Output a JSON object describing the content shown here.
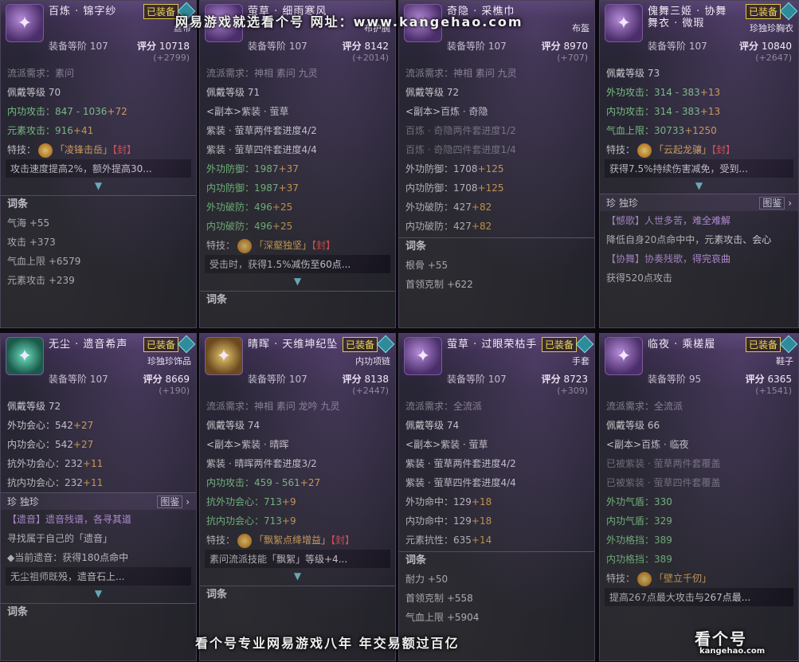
{
  "watermark_top": "网易游戏就选看个号  网址：www.kangehao.com",
  "watermark_bottom": "看个号专业网易游戏八年  年交易额过百亿",
  "logo_text": "看个号",
  "logo_sub": "kangehao.com",
  "labels": {
    "equipped": "已装备",
    "gear_level": "装备等阶",
    "score": "评分",
    "school_req": "流派需求：",
    "wear_level": "佩戴等级",
    "skill": "特技：",
    "entries": "词条",
    "rare": "珍 独珍",
    "tujian": "图鉴"
  },
  "cards": [
    {
      "title": "百炼 · 锦字纱",
      "subtype": "丝带",
      "gear_level": "107",
      "score": "10718",
      "plus": "(+2799)",
      "school": "素问",
      "wear_level": "70",
      "stats": [
        "内功攻击：847 - 1036",
        "元素攻击：916"
      ],
      "stat_bonus": [
        "+72",
        "+41"
      ],
      "skill_name": "「凌锋击岳」",
      "skill_seal": "【封】",
      "skill_desc": "攻击速度提高2%，额外提高30...",
      "entries": [
        "气海 +55",
        "攻击 +373",
        "气血上限 +6579",
        "元素攻击 +239"
      ]
    },
    {
      "title": "萤草 · 细雨寒风",
      "subtype": "布护腕",
      "gear_level": "107",
      "score": "8142",
      "plus": "(+2014)",
      "school": "神相 素问 九灵",
      "wear_level": "71",
      "sets": [
        "<副本>紫装 · 萤草",
        "紫装 · 萤草两件套进度4/2",
        "紫装 · 萤草四件套进度4/4"
      ],
      "stats": [
        "外功防御：1987",
        "内功防御：1987",
        "外功破防：496",
        "内功破防：496"
      ],
      "stat_bonus": [
        "+37",
        "+37",
        "+25",
        "+25"
      ],
      "skill_name": "「深壑独坚」",
      "skill_seal": "【封】",
      "skill_desc": "受击时，获得1.5%减伤至60点...",
      "entries_label": "词条"
    },
    {
      "title": "奇隐 · 采樵巾",
      "subtype": "布盔",
      "gear_level": "107",
      "score": "8970",
      "plus": "(+707)",
      "school": "神相 素问 九灵",
      "wear_level": "72",
      "sets": [
        "<副本>百炼 · 奇隐",
        "百炼 · 奇隐两件套进度1/2",
        "百炼 · 奇隐四件套进度1/4"
      ],
      "stats": [
        "外功防御：1708",
        "内功防御：1708",
        "外功破防：427",
        "内功破防：427"
      ],
      "stat_bonus": [
        "+125",
        "+125",
        "+82",
        "+82"
      ],
      "entries": [
        "根骨 +55",
        "首领克制 +622"
      ]
    },
    {
      "title": "傀舞三姬 · 协舞 舞衣 · 微瑕",
      "subtype": "珍独珍胸衣",
      "gear_level": "107",
      "score": "10840",
      "plus": "(+2647)",
      "wear_level": "73",
      "stats": [
        "外功攻击：314 - 383",
        "内功攻击：314 - 383",
        "气血上限：30733"
      ],
      "stat_bonus": [
        "+13",
        "+13",
        "+1250"
      ],
      "skill_name": "「云起龙骧」",
      "skill_seal": "【封】",
      "skill_desc": "获得7.5%持续伤害减免，受到...",
      "rare_lines": [
        "【憾歌】人世多苦，难全难解",
        "降低自身20点命中中，元素攻击、会心",
        "【协舞】协奏残歌，得完哀曲",
        "获得520点攻击"
      ]
    },
    {
      "title": "无尘 · 遗音希声",
      "subtype": "珍独珍饰品",
      "gear_level": "107",
      "score": "8669",
      "plus": "(+190)",
      "wear_level": "72",
      "stats": [
        "外功会心：542",
        "内功会心：542",
        "抗外功会心：232",
        "抗内功会心：232"
      ],
      "stat_bonus": [
        "+27",
        "+27",
        "+11",
        "+11"
      ],
      "rare_lines": [
        "【遗音】遗音残谱，各寻其道",
        "寻找属于自己的「遗音」",
        "◆当前遗音：获得180点命中"
      ],
      "skill_desc": "无尘祖师既殁，遗音石上...",
      "entries_label": "词条"
    },
    {
      "title": "晴晖 · 天维坤纪坠",
      "subtype": "内功项链",
      "gear_level": "107",
      "score": "8138",
      "plus": "(+2447)",
      "school": "神相 素问 龙吟 九灵",
      "wear_level": "74",
      "sets": [
        "<副本>紫装 · 晴晖",
        "紫装 · 晴晖两件套进度3/2"
      ],
      "stats": [
        "内功攻击：459 - 561",
        "抗外功会心：713",
        "抗内功会心：713"
      ],
      "stat_bonus": [
        "+27",
        "+9",
        "+9"
      ],
      "skill_name": "「飘絮点绛增益」",
      "skill_seal": "【封】",
      "skill_desc": "素问流派技能「飘絮」等级+4...",
      "entries_label": "词条"
    },
    {
      "title": "萤草 · 过眼荣枯手",
      "subtype": "手套",
      "gear_level": "107",
      "score": "8723",
      "plus": "(+309)",
      "school": "全流派",
      "wear_level": "74",
      "sets": [
        "<副本>紫装 · 萤草",
        "紫装 · 萤草两件套进度4/2",
        "紫装 · 萤草四件套进度4/4"
      ],
      "stats": [
        "外功命中：129",
        "内功命中：129",
        "元素抗性：635"
      ],
      "stat_bonus": [
        "+18",
        "+18",
        "+14"
      ],
      "entries": [
        "耐力 +50",
        "首领克制 +558",
        "气血上限 +5904"
      ]
    },
    {
      "title": "临夜 · 乘槎履",
      "subtype": "鞋子",
      "gear_level": "95",
      "score": "6365",
      "plus": "(+1541)",
      "school": "全流派",
      "wear_level": "66",
      "sets": [
        "<副本>百炼 · 临夜",
        "已被紫装 · 萤草两件套覆盖",
        "已被紫装 · 萤草四件套覆盖"
      ],
      "stats": [
        "外功气盾：330",
        "内功气盾：329",
        "外功格挡：389",
        "内功格挡：389"
      ],
      "skill_name": "「壁立千仞」",
      "skill_desc": "提高267点最大攻击与267点最..."
    }
  ]
}
